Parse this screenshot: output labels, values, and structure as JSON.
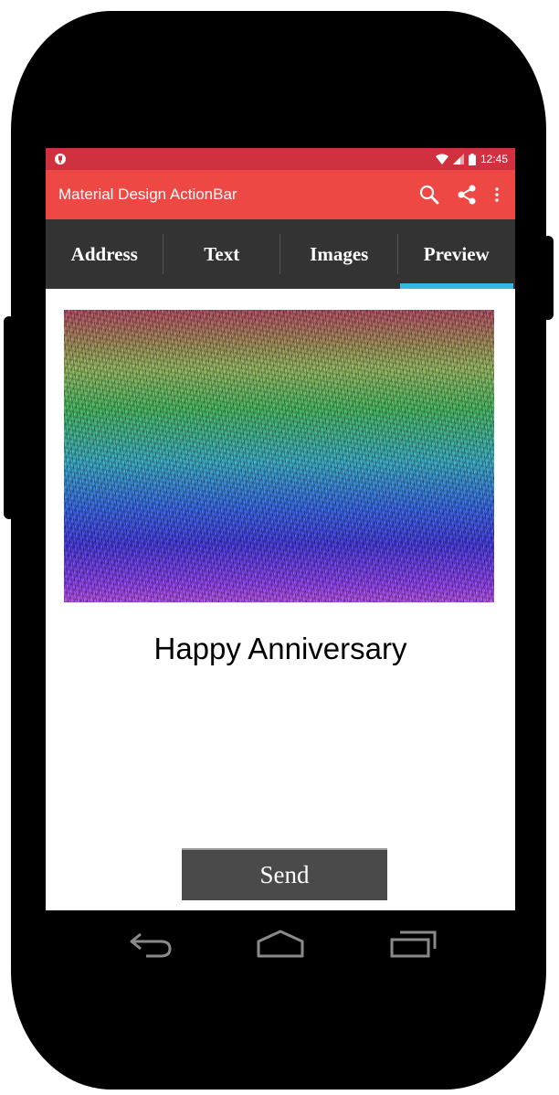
{
  "status_bar": {
    "time": "12:45",
    "icons": [
      "android-notification-icon",
      "wifi-icon",
      "signal-icon",
      "battery-icon"
    ]
  },
  "action_bar": {
    "title": "Material Design ActionBar",
    "actions": [
      "search-icon",
      "share-icon",
      "overflow-menu-icon"
    ]
  },
  "tabs": [
    {
      "label": "Address",
      "selected": false
    },
    {
      "label": "Text",
      "selected": false
    },
    {
      "label": "Images",
      "selected": false
    },
    {
      "label": "Preview",
      "selected": true
    }
  ],
  "preview": {
    "image": "rainbow-noise-stereogram",
    "message": "Happy Anniversary"
  },
  "send_label": "Send",
  "nav_bar": [
    "back-icon",
    "home-icon",
    "recent-apps-icon"
  ],
  "colors": {
    "status_bar": "#d0313f",
    "action_bar": "#ee4844",
    "tab_bar": "#333333",
    "tab_indicator": "#34b7e0",
    "send_button": "#4a4a4a"
  }
}
